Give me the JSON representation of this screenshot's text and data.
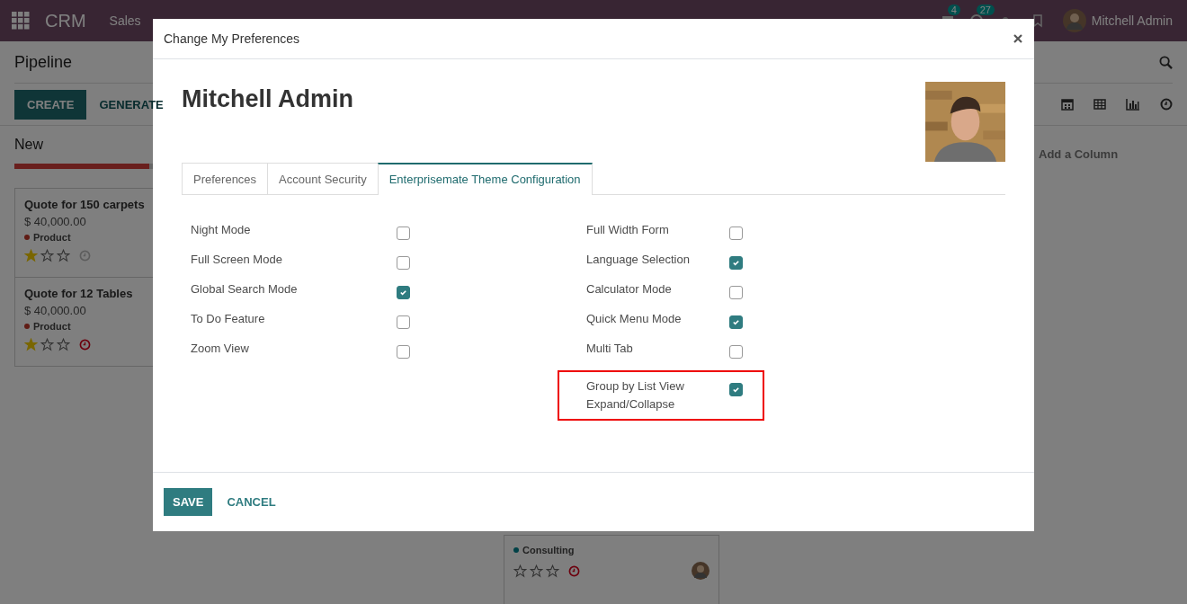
{
  "navbar": {
    "app_name": "CRM",
    "menu": [
      "Sales"
    ],
    "message_count": "4",
    "activity_count": "27",
    "user": "Mitchell Admin"
  },
  "control_panel": {
    "title": "Pipeline",
    "buttons": [
      "CREATE",
      "GENERATE"
    ]
  },
  "kanban": {
    "columns": [
      {
        "title": "New",
        "progress": {
          "level": 0.6
        },
        "cards": [
          {
            "title": "Quote for 150 carpets",
            "amount": "$ 40,000.00",
            "tag": "Product",
            "color": "#601c15",
            "stars": 1,
            "overdue": false
          },
          {
            "title": "Quote for 12 Tables",
            "amount": "$ 40,000.00",
            "tag": "Product",
            "color": "#601c15",
            "stars": 1,
            "overdue": true
          }
        ]
      },
      {
        "cards": [
          {
            "tag": "Consulting",
            "color": "#004147",
            "stars": 0,
            "overdue": true,
            "avatar": true
          }
        ]
      }
    ],
    "add_column": "Add a Column"
  },
  "dialog": {
    "title": "Change My Preferences",
    "user_name": "Mitchell Admin",
    "tabs": [
      {
        "label": "Preferences",
        "selected": false
      },
      {
        "label": "Account Security",
        "selected": false
      },
      {
        "label": "Enterprisemate Theme Configuration",
        "selected": true
      }
    ],
    "left_options": [
      {
        "label": "Night Mode",
        "checked": false
      },
      {
        "label": "Full Screen Mode",
        "checked": false
      },
      {
        "label": "Global Search Mode",
        "checked": true
      },
      {
        "label": "To Do Feature",
        "checked": false
      },
      {
        "label": "Zoom View",
        "checked": false
      }
    ],
    "right_options": [
      {
        "label": "Full Width Form",
        "checked": false
      },
      {
        "label": "Language Selection",
        "checked": true
      },
      {
        "label": "Calculator Mode",
        "checked": false
      },
      {
        "label": "Quick Menu Mode",
        "checked": true
      },
      {
        "label": "Multi Tab",
        "checked": false
      },
      {
        "label": "Group by List View Expand/Collapse",
        "checked": true,
        "highlighted": true
      }
    ],
    "buttons": [
      {
        "label": "SAVE",
        "kind": "primary"
      },
      {
        "label": "CANCEL",
        "kind": "link"
      }
    ]
  }
}
